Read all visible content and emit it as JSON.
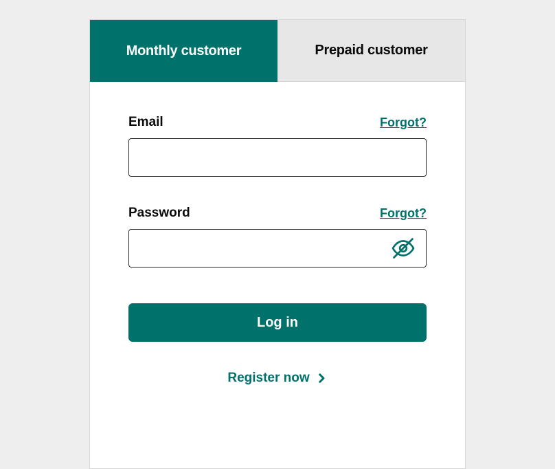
{
  "tabs": {
    "monthly": "Monthly customer",
    "prepaid": "Prepaid customer"
  },
  "form": {
    "email": {
      "label": "Email",
      "forgot": "Forgot?",
      "value": ""
    },
    "password": {
      "label": "Password",
      "forgot": "Forgot?",
      "value": ""
    },
    "loginButton": "Log in",
    "registerLink": "Register now"
  }
}
